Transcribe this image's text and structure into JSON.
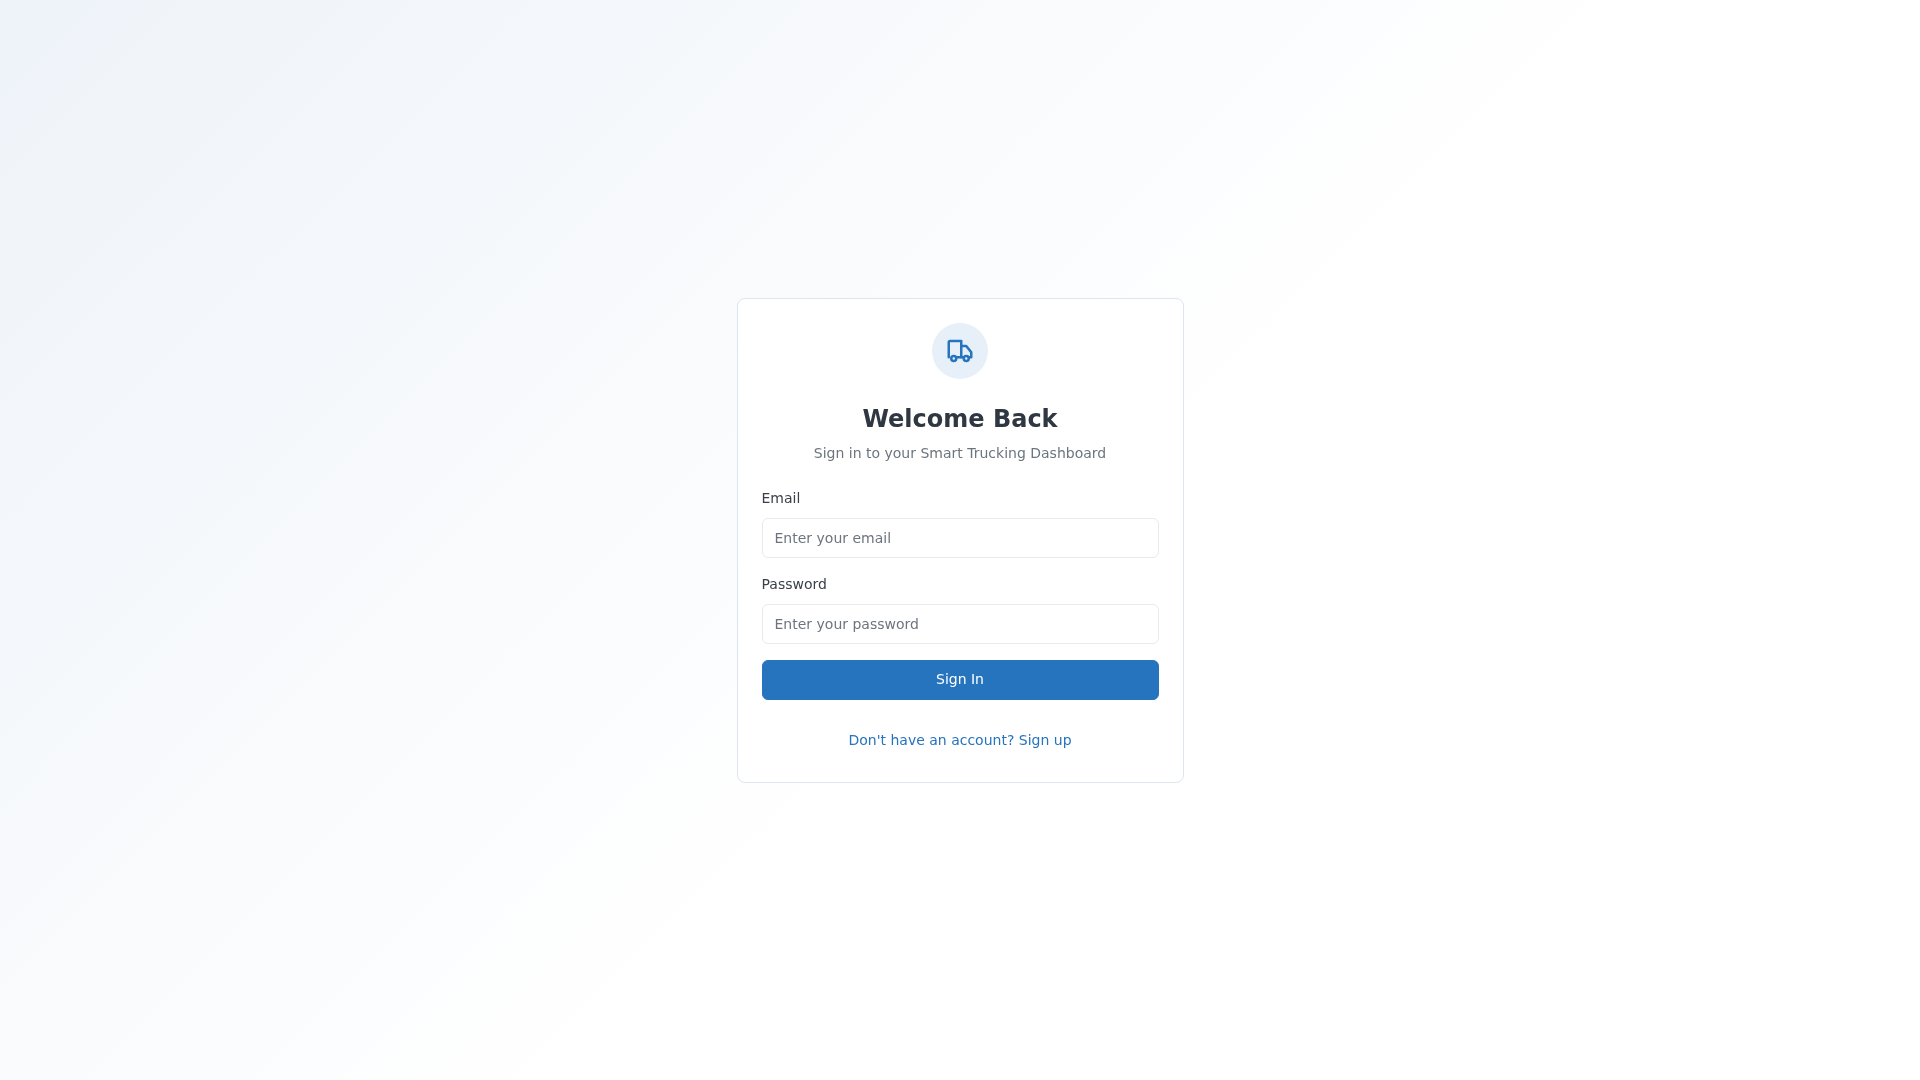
{
  "header": {
    "title": "Welcome Back",
    "subtitle": "Sign in to your Smart Trucking Dashboard"
  },
  "fields": [
    {
      "label": "Email",
      "placeholder": "Enter your email"
    },
    {
      "label": "Password",
      "placeholder": "Enter your password"
    }
  ],
  "submit": "Sign In",
  "footer_link": "Don't have an account? Sign up"
}
